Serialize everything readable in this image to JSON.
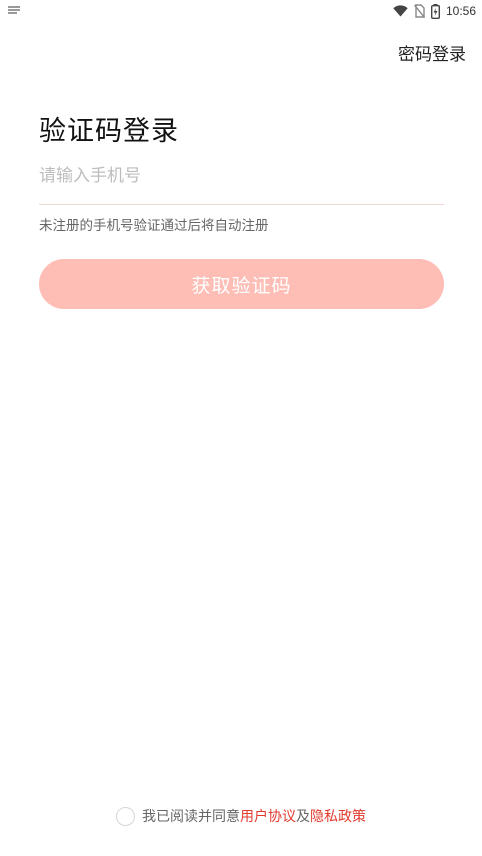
{
  "status_bar": {
    "time": "10:56",
    "icons": [
      "wifi-icon",
      "no-sim-icon",
      "battery-icon"
    ]
  },
  "header": {
    "password_login_label": "密码登录"
  },
  "main": {
    "title": "验证码登录",
    "phone_input": {
      "placeholder": "请输入手机号",
      "value": ""
    },
    "hint": "未注册的手机号验证通过后将自动注册",
    "get_code_label": "获取验证码"
  },
  "agreement": {
    "prefix": "我已阅读并同意",
    "user_agreement": "用户协议",
    "and": "及",
    "privacy_policy": "隐私政策",
    "checked": false
  },
  "colors": {
    "accent": "#e23b2e",
    "button_bg": "#febeb5",
    "placeholder": "#bdbdbd"
  }
}
